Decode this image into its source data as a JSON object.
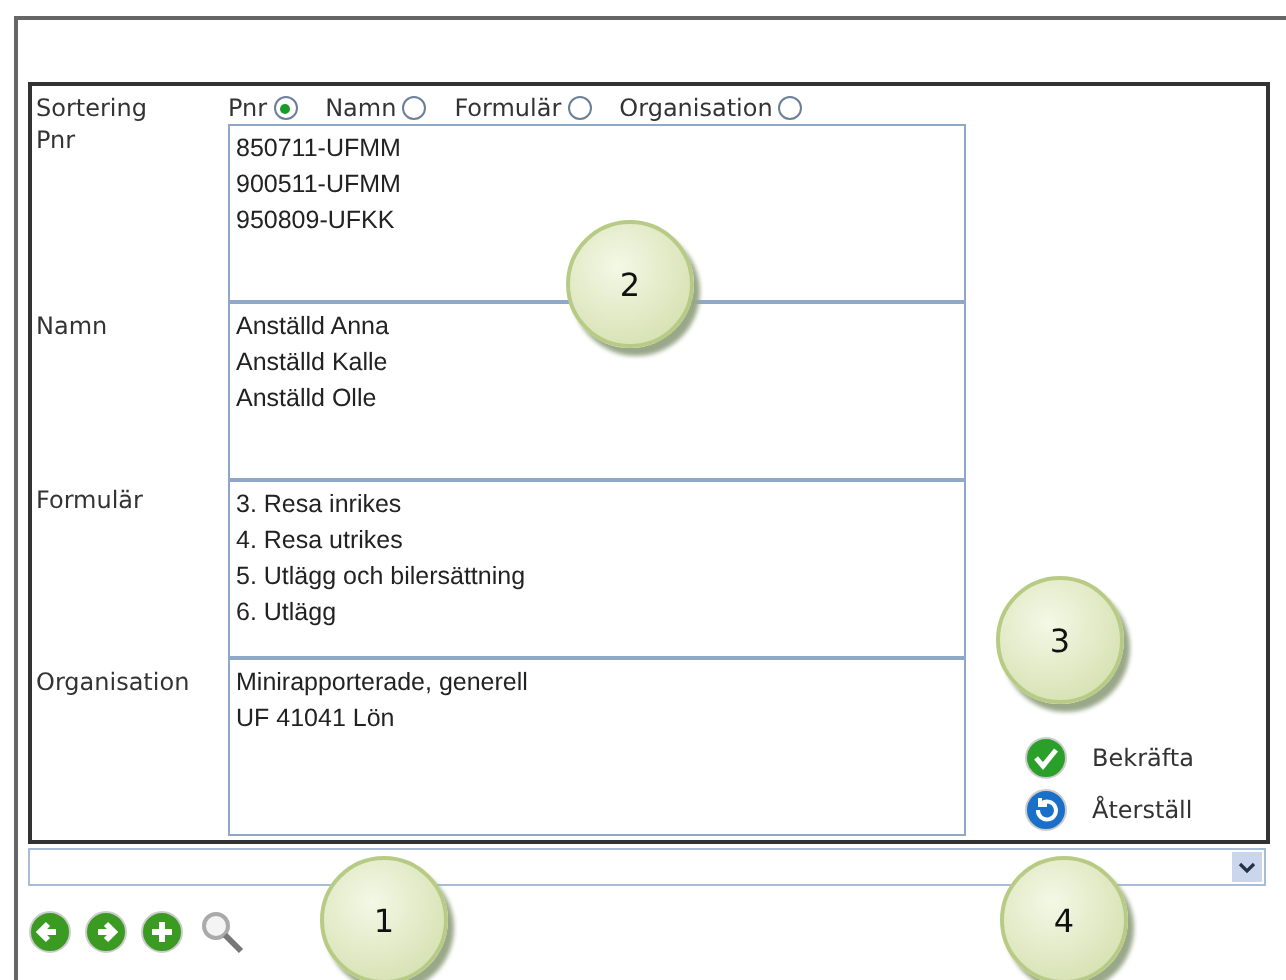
{
  "sort": {
    "label": "Sortering",
    "options": [
      {
        "label": "Pnr",
        "selected": true
      },
      {
        "label": "Namn",
        "selected": false
      },
      {
        "label": "Formulär",
        "selected": false
      },
      {
        "label": "Organisation",
        "selected": false
      }
    ]
  },
  "fields": [
    {
      "label": "Pnr",
      "items": [
        "850711-UFMM",
        "900511-UFMM",
        "950809-UFKK"
      ]
    },
    {
      "label": "Namn",
      "items": [
        "Anställd Anna",
        "Anställd Kalle",
        "Anställd Olle"
      ]
    },
    {
      "label": "Formulär",
      "items": [
        "3. Resa inrikes",
        "4. Resa utrikes",
        "5. Utlägg och bilersättning",
        "6. Utlägg"
      ]
    },
    {
      "label": "Organisation",
      "items": [
        "Minirapporterade, generell",
        "UF 41041 Lön"
      ]
    }
  ],
  "actions": [
    {
      "kind": "confirm",
      "label": "Bekräfta"
    },
    {
      "kind": "reset",
      "label": "Återställ"
    }
  ],
  "toolbar": [
    {
      "kind": "back"
    },
    {
      "kind": "forward"
    },
    {
      "kind": "add"
    },
    {
      "kind": "search"
    }
  ],
  "callouts": [
    "2",
    "3",
    "1",
    "4"
  ]
}
